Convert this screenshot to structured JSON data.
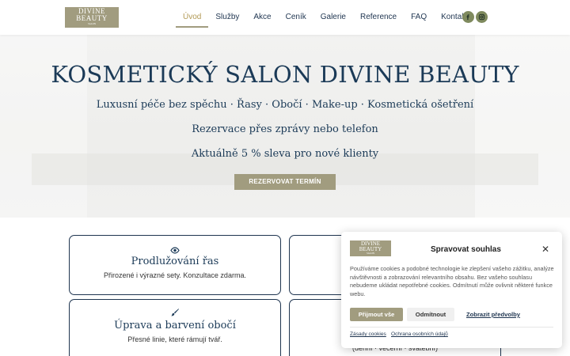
{
  "header": {
    "logo": {
      "line1": "DIVINE",
      "line2": "BEAUTY",
      "line3": "SALON"
    },
    "nav": [
      "Úvod",
      "Služby",
      "Akce",
      "Ceník",
      "Galerie",
      "Reference",
      "FAQ",
      "Kontakty"
    ],
    "active_nav": "Úvod",
    "social": [
      "facebook-icon",
      "instagram-icon"
    ]
  },
  "hero": {
    "title": "KOSMETICKÝ SALON DIVINE BEAUTY",
    "subtitle1": "Luxusní péče bez spěchu · Řasy · Obočí · Make-up · Kosmetická ošetření",
    "subtitle2": "Rezervace přes zprávy nebo telefon",
    "subtitle3": "Aktuálně 5 % sleva pro nové klienty",
    "cta": "REZERVOVAT TERMÍN"
  },
  "services": [
    {
      "icon": "eye-icon",
      "title": "Prodlužování řas",
      "desc": "Přirozené i výrazné sety. Konzultace zdarma."
    },
    {
      "icon": "",
      "title": "",
      "desc": ""
    },
    {
      "icon": "brush-icon",
      "title": "Úprava a barvení obočí",
      "desc": "Přesné linie, které rámují tvář."
    },
    {
      "icon": "",
      "title": "",
      "desc": "(denní · večerní · svatební)"
    }
  ],
  "consent": {
    "logo": {
      "line1": "DIVINE",
      "line2": "BEAUTY",
      "line3": "SALON"
    },
    "title": "Spravovat souhlas",
    "body": "Používáme cookies a podobné technologie ke zlepšení vašeho zážitku, analýze návštěvnosti a zobrazování relevantního obsahu. Bez vašeho souhlasu nebudeme ukládat nepotřebné cookies. Odmítnutí může ovlivnit některé funkce webu.",
    "accept": "Přijmout vše",
    "deny": "Odmítnout",
    "preferences": "Zobrazit předvolby",
    "link1": "Zásady cookies",
    "link2": "Ochrana osobních údajů"
  },
  "colors": {
    "accent": "#a19c7f",
    "navy": "#1b3a57",
    "active_nav": "#b29a56"
  }
}
